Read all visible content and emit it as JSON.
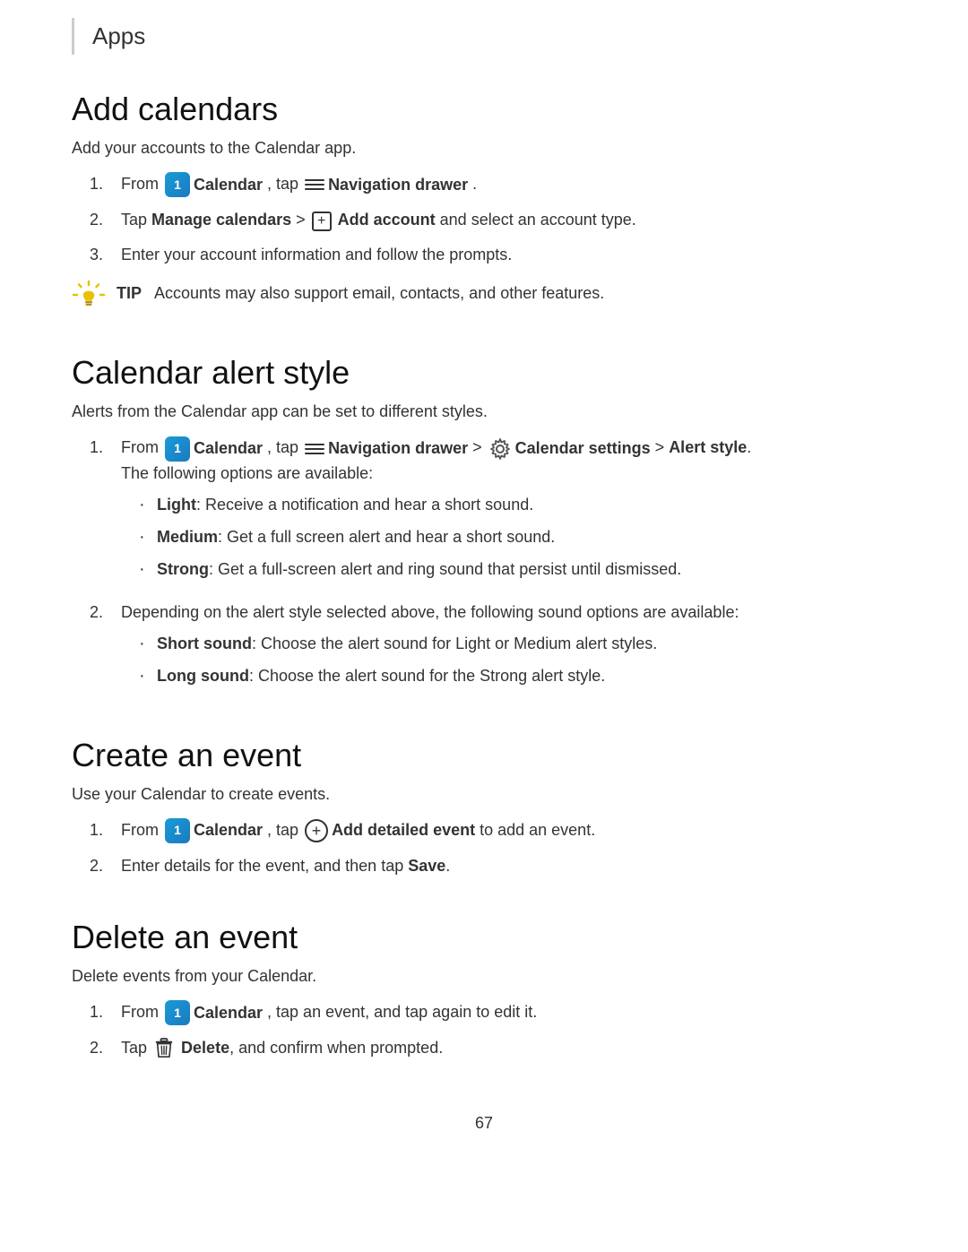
{
  "header": {
    "title": "Apps",
    "border_color": "#cccccc"
  },
  "sections": [
    {
      "id": "add-calendars",
      "title": "Add calendars",
      "intro": "Add your accounts to the Calendar app.",
      "steps": [
        {
          "number": "1.",
          "has_icons": true,
          "text_parts": [
            "From",
            "Calendar",
            ", tap",
            "Navigation drawer",
            "."
          ],
          "icons": [
            "calendar",
            "nav-drawer"
          ]
        },
        {
          "number": "2.",
          "has_icons": true,
          "text_parts": [
            "Tap ",
            "Manage calendars",
            " > ",
            "Add account",
            " and select an account type."
          ],
          "icons": [
            "plus-box"
          ]
        },
        {
          "number": "3.",
          "text": "Enter your account information and follow the prompts."
        }
      ],
      "tip": {
        "label": "TIP",
        "text": "Accounts may also support email, contacts, and other features."
      }
    },
    {
      "id": "calendar-alert-style",
      "title": "Calendar alert style",
      "intro": "Alerts from the Calendar app can be set to different styles.",
      "steps": [
        {
          "number": "1.",
          "has_icons": true,
          "text_parts": [
            "From",
            "Calendar",
            ", tap",
            "Navigation drawer",
            ">",
            "Calendar settings",
            "> ",
            "Alert style",
            "."
          ],
          "icons": [
            "calendar",
            "nav-drawer",
            "settings"
          ],
          "sub_text": "The following options are available:",
          "bullets": [
            {
              "bold": "Light",
              "text": ": Receive a notification and hear a short sound."
            },
            {
              "bold": "Medium",
              "text": ": Get a full screen alert and hear a short sound."
            },
            {
              "bold": "Strong",
              "text": ": Get a full-screen alert and ring sound that persist until dismissed."
            }
          ]
        },
        {
          "number": "2.",
          "text": "Depending on the alert style selected above, the following sound options are available:",
          "bullets": [
            {
              "bold": "Short sound",
              "text": ": Choose the alert sound for Light or Medium alert styles."
            },
            {
              "bold": "Long sound",
              "text": ": Choose the alert sound for the Strong alert style."
            }
          ]
        }
      ]
    },
    {
      "id": "create-event",
      "title": "Create an event",
      "intro": "Use your Calendar to create events.",
      "steps": [
        {
          "number": "1.",
          "has_icons": true,
          "text_parts": [
            "From",
            "Calendar",
            ", tap",
            "Add detailed event",
            "to add an event."
          ],
          "icons": [
            "calendar",
            "add-circle"
          ]
        },
        {
          "number": "2.",
          "text_parts": [
            "Enter details for the event, and then tap ",
            "Save",
            "."
          ],
          "has_bold_end": true
        }
      ]
    },
    {
      "id": "delete-event",
      "title": "Delete an event",
      "intro": "Delete events from your Calendar.",
      "steps": [
        {
          "number": "1.",
          "has_icons": true,
          "text_parts": [
            "From",
            "Calendar",
            ", tap an event, and tap again to edit it."
          ],
          "icons": [
            "calendar"
          ]
        },
        {
          "number": "2.",
          "has_icons": true,
          "text_parts": [
            "Tap",
            "Delete",
            ", and confirm when prompted."
          ],
          "icons": [
            "trash"
          ]
        }
      ]
    }
  ],
  "page_number": "67",
  "colors": {
    "calendar_icon_bg": "#1a9bd7",
    "accent": "#1a7abf",
    "text_primary": "#1a1a1a",
    "text_secondary": "#333333"
  }
}
